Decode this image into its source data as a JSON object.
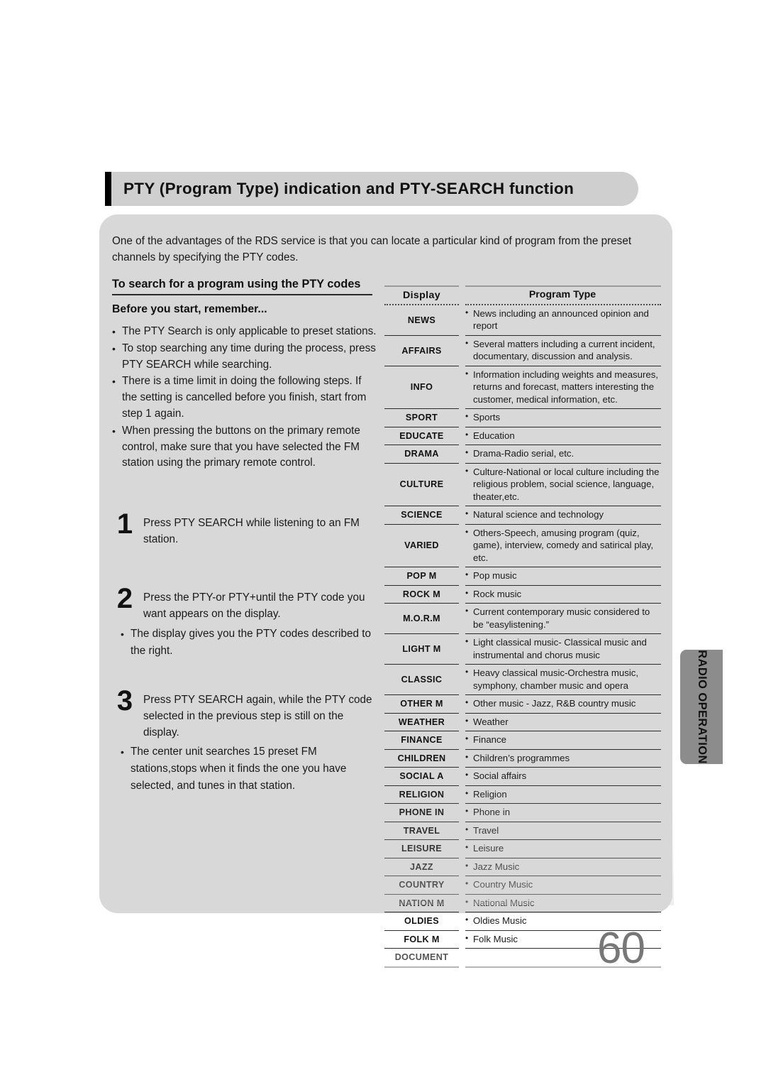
{
  "section": {
    "title": "PTY (Program Type) indication and PTY-SEARCH function"
  },
  "intro": "One  of the advantages of the RDS service is that you can locate a particular kind of program from the preset channels by specifying the PTY codes.",
  "left": {
    "sub_heading": "To search for a program using the PTY codes",
    "before_heading": "Before you start, remember...",
    "bullets": [
      "The PTY Search is only applicable to preset stations.",
      "To stop searching any time during the process, press PTY SEARCH while searching.",
      "There is a time limit in doing the following steps. If the setting is cancelled before you finish, start from step 1 again.",
      "When pressing the buttons on the primary remote control, make sure that you have selected the FM station using the primary remote control."
    ],
    "steps": [
      {
        "number": "1",
        "text": "Press PTY SEARCH while listening to an FM station.",
        "notes": []
      },
      {
        "number": "2",
        "text": "Press the PTY-or PTY+until the PTY code you want appears on the display.",
        "notes": [
          "The display gives you the PTY codes described to the right."
        ]
      },
      {
        "number": "3",
        "text": "Press PTY SEARCH again, while the PTY code selected in the previous step is still on the display.",
        "notes": [
          "The center unit searches 15 preset FM stations,stops when it finds the one you have selected, and tunes in that station."
        ]
      }
    ]
  },
  "table": {
    "headers": [
      "Display",
      "Program Type"
    ],
    "rows": [
      {
        "display": "NEWS",
        "type": "News including an announced opinion and report"
      },
      {
        "display": "AFFAIRS",
        "type": "Several matters including a current incident, documentary, discussion and analysis."
      },
      {
        "display": "INFO",
        "type": "Information including weights and measures, returns and forecast, matters interesting the customer, medical information, etc."
      },
      {
        "display": "SPORT",
        "type": "Sports"
      },
      {
        "display": "EDUCATE",
        "type": "Education"
      },
      {
        "display": "DRAMA",
        "type": "Drama-Radio serial, etc."
      },
      {
        "display": "CULTURE",
        "type": "Culture-National or local culture including the religious problem, social science, language, theater,etc."
      },
      {
        "display": "SCIENCE",
        "type": "Natural science and technology"
      },
      {
        "display": "VARIED",
        "type": "Others-Speech, amusing program (quiz, game), interview, comedy and satirical play, etc."
      },
      {
        "display": "POP M",
        "type": "Pop music"
      },
      {
        "display": "ROCK M",
        "type": "Rock music"
      },
      {
        "display": "M.O.R.M",
        "type": "Current contemporary music considered to be “easylistening.”"
      },
      {
        "display": "LIGHT M",
        "type": "Light classical music- Classical music and instrumental and chorus music"
      },
      {
        "display": "CLASSIC",
        "type": "Heavy classical  music-Orchestra music, symphony, chamber music and opera"
      },
      {
        "display": "OTHER M",
        "type": "Other music - Jazz, R&B country music"
      },
      {
        "display": "WEATHER",
        "type": "Weather"
      },
      {
        "display": "FINANCE",
        "type": "Finance"
      },
      {
        "display": "CHILDREN",
        "type": "Children’s programmes"
      },
      {
        "display": "SOCIAL A",
        "type": "Social affairs"
      },
      {
        "display": "RELIGION",
        "type": "Religion"
      },
      {
        "display": "PHONE IN",
        "type": "Phone in"
      },
      {
        "display": "TRAVEL",
        "type": "Travel"
      },
      {
        "display": "LEISURE",
        "type": "Leisure"
      },
      {
        "display": "JAZZ",
        "type": "Jazz Music"
      },
      {
        "display": "COUNTRY",
        "type": "Country Music"
      },
      {
        "display": "NATION M",
        "type": "National Music"
      },
      {
        "display": "OLDIES",
        "type": "Oldies Music"
      },
      {
        "display": "FOLK M",
        "type": "Folk Music"
      },
      {
        "display": "DOCUMENT",
        "type": ""
      }
    ]
  },
  "side_tab": {
    "label": "RADIO OPERATION"
  },
  "page_number": "60",
  "colors": {
    "panel": "#d8d8d8",
    "title_bar": "#cfcfcf",
    "title_accent": "#000000",
    "side_tab": "#8c8c8c",
    "page_number": "#777777",
    "rule": "#2b2b2b"
  }
}
